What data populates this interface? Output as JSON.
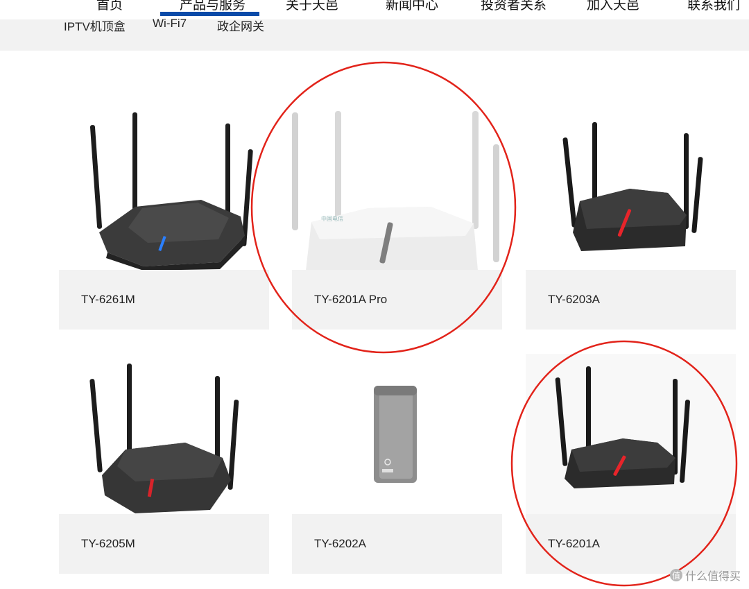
{
  "nav": {
    "items": [
      "首页",
      "产品与服务",
      "关于天邑",
      "新闻中心",
      "投资者关系",
      "加入天邑",
      "联系我们"
    ],
    "active": "产品与服务"
  },
  "subnav": {
    "items": [
      "IPTV机顶盒",
      "Wi-Fi7",
      "政企网关"
    ]
  },
  "products": [
    {
      "model": "TY-6261M",
      "image": "black-router-blue-led-icon"
    },
    {
      "model": "TY-6201A Pro",
      "image": "white-router-icon"
    },
    {
      "model": "TY-6203A",
      "image": "black-router-red-led-icon"
    },
    {
      "model": "TY-6205M",
      "image": "black-router-red-led-icon"
    },
    {
      "model": "TY-6202A",
      "image": "gray-tower-device-icon"
    },
    {
      "model": "TY-6201A",
      "image": "black-router-red-led-icon"
    }
  ],
  "watermark": {
    "badge": "值",
    "text": "什么值得买"
  },
  "colors": {
    "accent": "#0a4aa8",
    "annotation": "#e2231a",
    "card_bg": "#f2f2f2"
  }
}
